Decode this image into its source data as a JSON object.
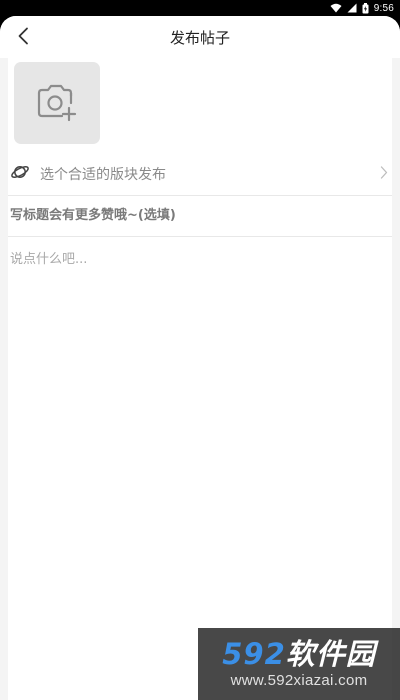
{
  "status_bar": {
    "time": "9:56",
    "icons": [
      "wifi-icon",
      "signal-icon",
      "battery-icon"
    ]
  },
  "header": {
    "title": "发布帖子",
    "back_icon": "chevron-left-icon"
  },
  "photo_picker": {
    "icon": "camera-plus-icon"
  },
  "board_selector": {
    "icon": "planet-icon",
    "label": "选个合适的版块发布",
    "chevron_icon": "chevron-right-icon"
  },
  "title_field": {
    "placeholder": "写标题会有更多赞哦~(选填)",
    "value": ""
  },
  "body_field": {
    "placeholder": "说点什么吧...",
    "value": ""
  },
  "watermark": {
    "brand_number": "592",
    "brand_text": "软件园",
    "url": "www.592xiazai.com"
  },
  "colors": {
    "background": "#f4f4f4",
    "card": "#ffffff",
    "placeholder": "#a8a8a8",
    "watermark_blue": "#3b8fe6"
  }
}
